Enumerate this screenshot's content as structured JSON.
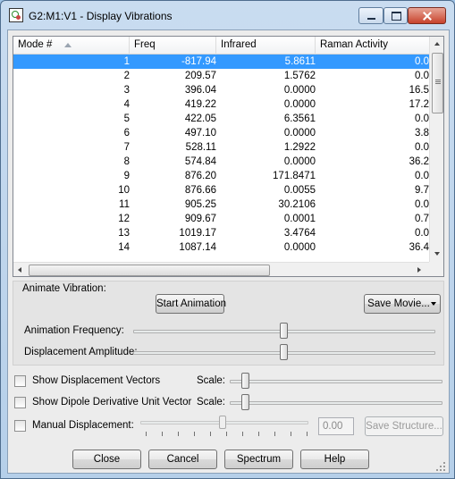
{
  "window": {
    "title": "G2:M1:V1 - Display Vibrations"
  },
  "table": {
    "columns": [
      "Mode #",
      "Freq",
      "Infrared",
      "Raman Activity"
    ],
    "selected_row": 0,
    "rows": [
      {
        "mode": "1",
        "freq": "-817.94",
        "ir": "5.8611",
        "raman": "0.0"
      },
      {
        "mode": "2",
        "freq": "209.57",
        "ir": "1.5762",
        "raman": "0.0"
      },
      {
        "mode": "3",
        "freq": "396.04",
        "ir": "0.0000",
        "raman": "16.5"
      },
      {
        "mode": "4",
        "freq": "419.22",
        "ir": "0.0000",
        "raman": "17.2"
      },
      {
        "mode": "5",
        "freq": "422.05",
        "ir": "6.3561",
        "raman": "0.0"
      },
      {
        "mode": "6",
        "freq": "497.10",
        "ir": "0.0000",
        "raman": "3.8"
      },
      {
        "mode": "7",
        "freq": "528.11",
        "ir": "1.2922",
        "raman": "0.0"
      },
      {
        "mode": "8",
        "freq": "574.84",
        "ir": "0.0000",
        "raman": "36.2"
      },
      {
        "mode": "9",
        "freq": "876.20",
        "ir": "171.8471",
        "raman": "0.0"
      },
      {
        "mode": "10",
        "freq": "876.66",
        "ir": "0.0055",
        "raman": "9.7"
      },
      {
        "mode": "11",
        "freq": "905.25",
        "ir": "30.2106",
        "raman": "0.0"
      },
      {
        "mode": "12",
        "freq": "909.67",
        "ir": "0.0001",
        "raman": "0.7"
      },
      {
        "mode": "13",
        "freq": "1019.17",
        "ir": "3.4764",
        "raman": "0.0"
      },
      {
        "mode": "14",
        "freq": "1087.14",
        "ir": "0.0000",
        "raman": "36.4"
      }
    ]
  },
  "animate": {
    "group_label": "Animate Vibration:",
    "start_button": "Start Animation",
    "save_movie_button": "Save Movie...",
    "frequency_label": "Animation Frequency:",
    "frequency_level": 0.5,
    "amplitude_label": "Displacement Amplitude:",
    "amplitude_level": 0.5
  },
  "options": {
    "show_vectors_label": "Show Displacement Vectors",
    "show_vectors_checked": false,
    "show_dipole_label": "Show Dipole Derivative Unit Vector",
    "show_dipole_checked": false,
    "scale_label": "Scale:",
    "manual_label": "Manual Displacement:",
    "manual_checked": false,
    "manual_value": "0.00",
    "save_structure_button": "Save Structure..."
  },
  "buttons": {
    "close": "Close",
    "cancel": "Cancel",
    "spectrum": "Spectrum",
    "help": "Help"
  }
}
